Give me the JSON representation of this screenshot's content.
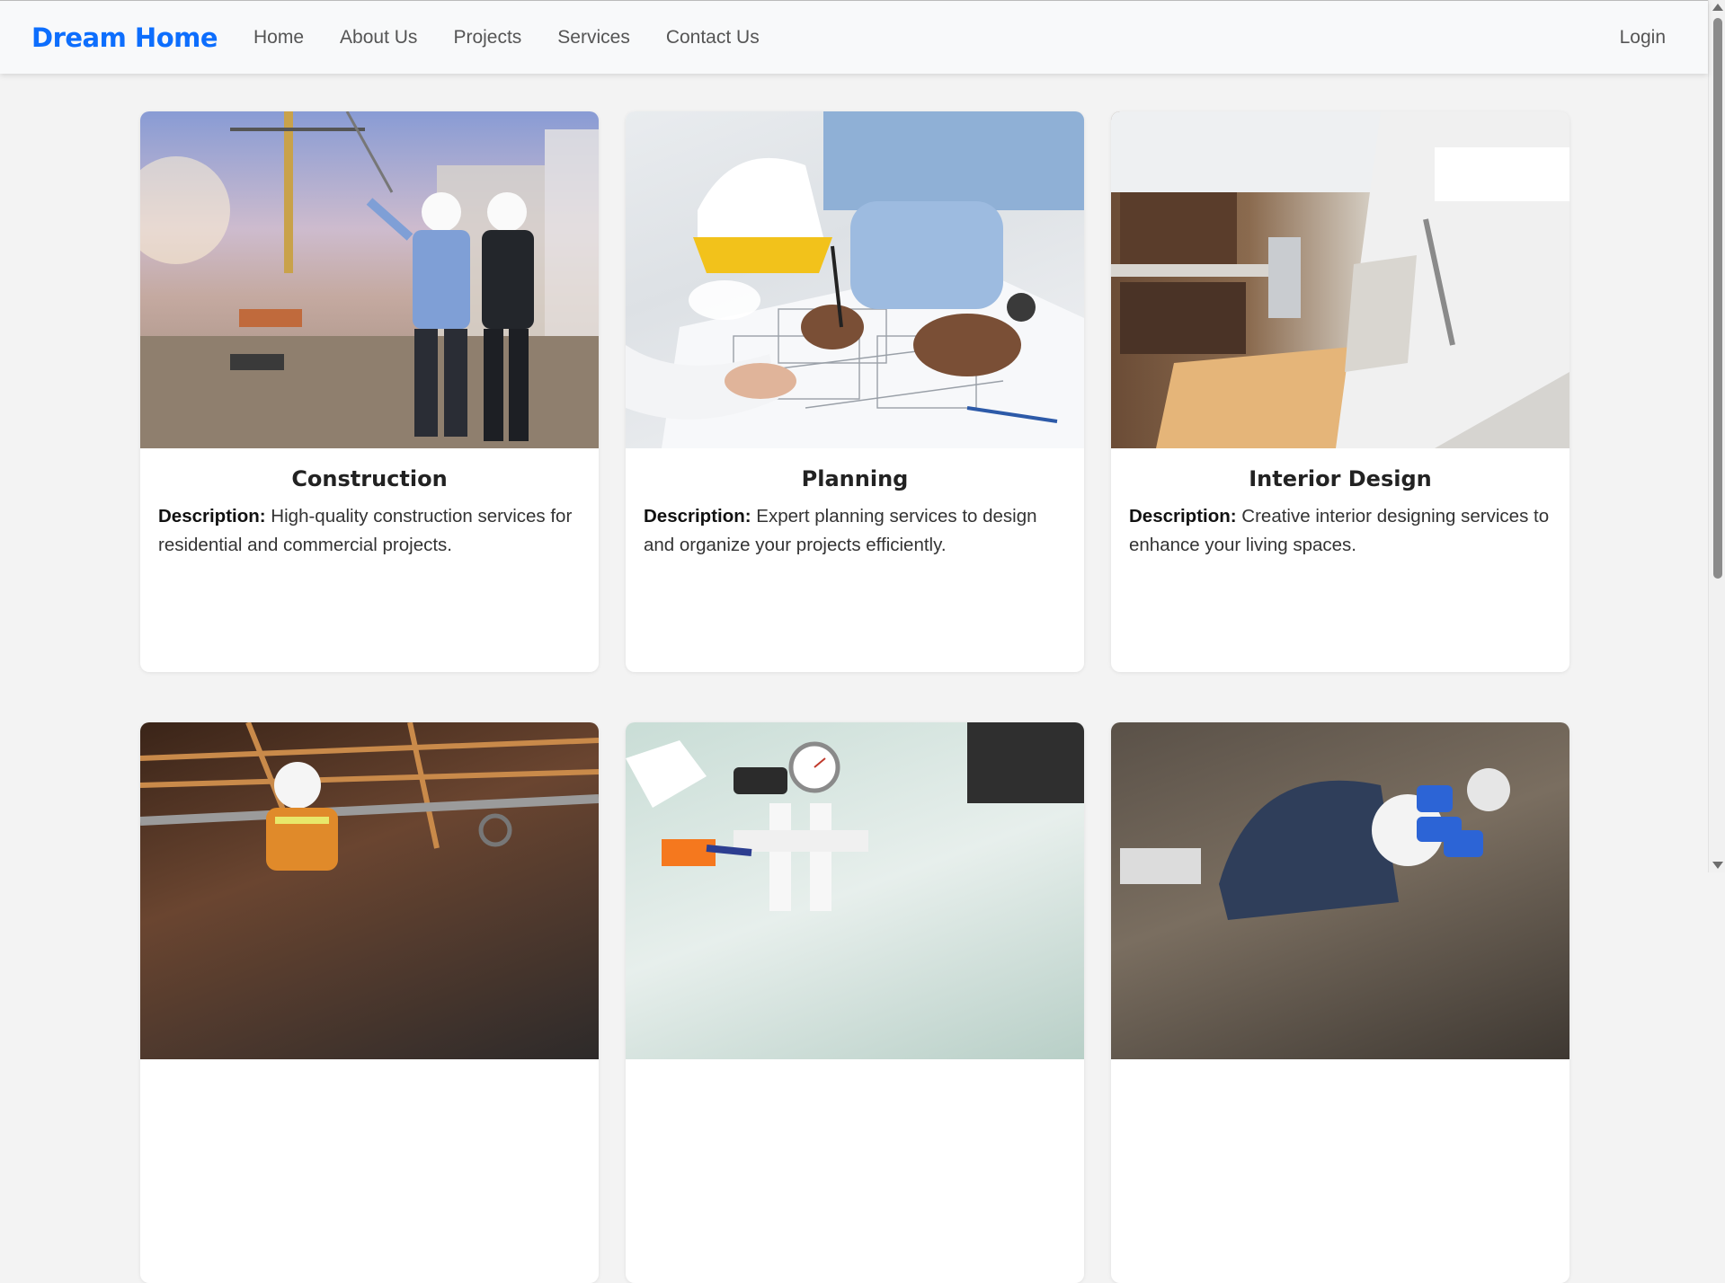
{
  "navbar": {
    "brand": "Dream Home",
    "links": [
      "Home",
      "About Us",
      "Projects",
      "Services",
      "Contact Us"
    ],
    "login": "Login"
  },
  "services": [
    {
      "title": "Construction",
      "description_label": "Description:",
      "description": " High-quality construction services for residential and commercial projects."
    },
    {
      "title": "Planning",
      "description_label": "Description:",
      "description": " Expert planning services to design and organize your projects efficiently."
    },
    {
      "title": "Interior Design",
      "description_label": "Description:",
      "description": " Creative interior designing services to enhance your living spaces."
    }
  ],
  "colors": {
    "brand": "#0d6efd",
    "page_background": "#f3f3f3",
    "navbar_background": "#f8f9fa"
  }
}
